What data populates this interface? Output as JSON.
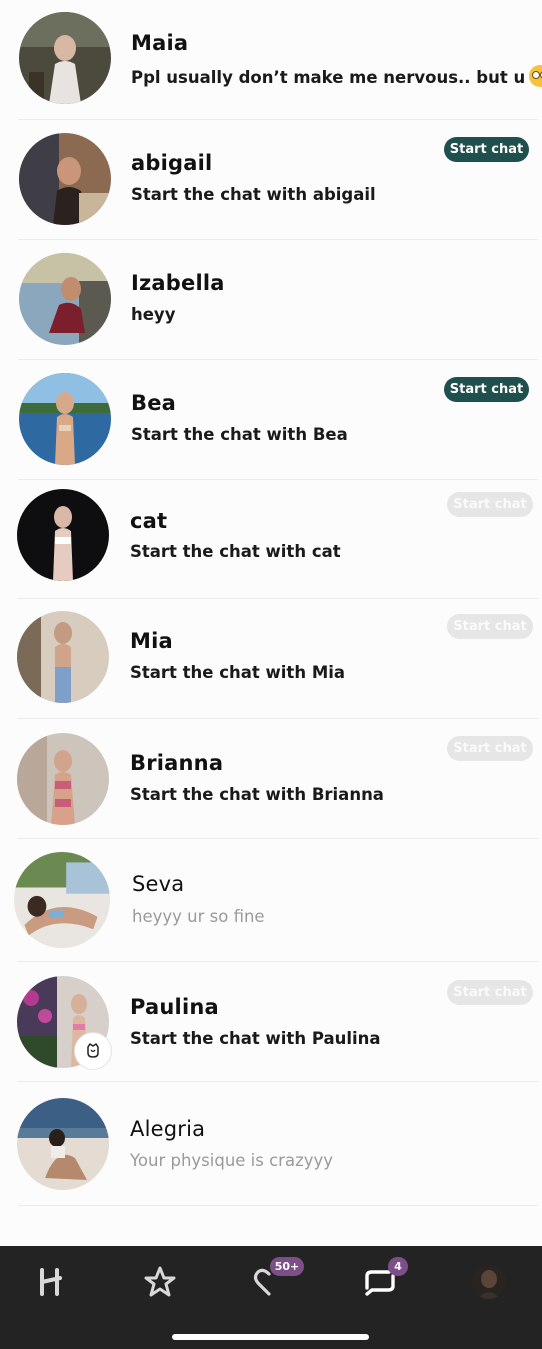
{
  "conversations": [
    {
      "name": "Maia",
      "message": "Ppl usually don’t make me nervous.. but u",
      "emoji": "flushed-face-emoji",
      "button": null,
      "unread": true
    },
    {
      "name": "abigail",
      "message": "Start the chat with abigail",
      "button": "Start chat",
      "button_state": "active",
      "unread": true
    },
    {
      "name": "Izabella",
      "message": "heyy",
      "button": null,
      "unread": true
    },
    {
      "name": "Bea",
      "message": "Start the chat with Bea",
      "button": "Start chat",
      "button_state": "active",
      "unread": true
    },
    {
      "name": "cat",
      "message": "Start the chat with cat",
      "button": "Start chat",
      "button_state": "faded",
      "unread": true
    },
    {
      "name": "Mia",
      "message": "Start the chat with Mia",
      "button": "Start chat",
      "button_state": "faded",
      "unread": true
    },
    {
      "name": "Brianna",
      "message": "Start the chat with Brianna",
      "button": "Start chat",
      "button_state": "faded",
      "unread": true
    },
    {
      "name": "Seva",
      "message": "heyyy ur so fine",
      "button": null,
      "unread": false
    },
    {
      "name": "Paulina",
      "message": "Start the chat with Paulina",
      "button": "Start chat",
      "button_state": "faded",
      "unread": true,
      "avatar_badge": "rose-icon"
    },
    {
      "name": "Alegria",
      "message": "Your physique is crazyyy",
      "button": null,
      "unread": false
    }
  ],
  "tabbar": {
    "tabs": [
      {
        "icon": "hinge-logo-icon",
        "badge": null
      },
      {
        "icon": "star-icon",
        "badge": null
      },
      {
        "icon": "likes-heart-icon",
        "badge": "50+"
      },
      {
        "icon": "chat-bubbles-icon",
        "badge": "4",
        "active": true
      },
      {
        "icon": "profile-avatar-icon",
        "badge": null
      }
    ]
  },
  "colors": {
    "start_chat_active": "#20504d",
    "start_chat_faded": "#e6e6e6",
    "badge": "#7d4f88",
    "tabbar_bg": "#232323",
    "page_bg": "#fdfcfc"
  }
}
